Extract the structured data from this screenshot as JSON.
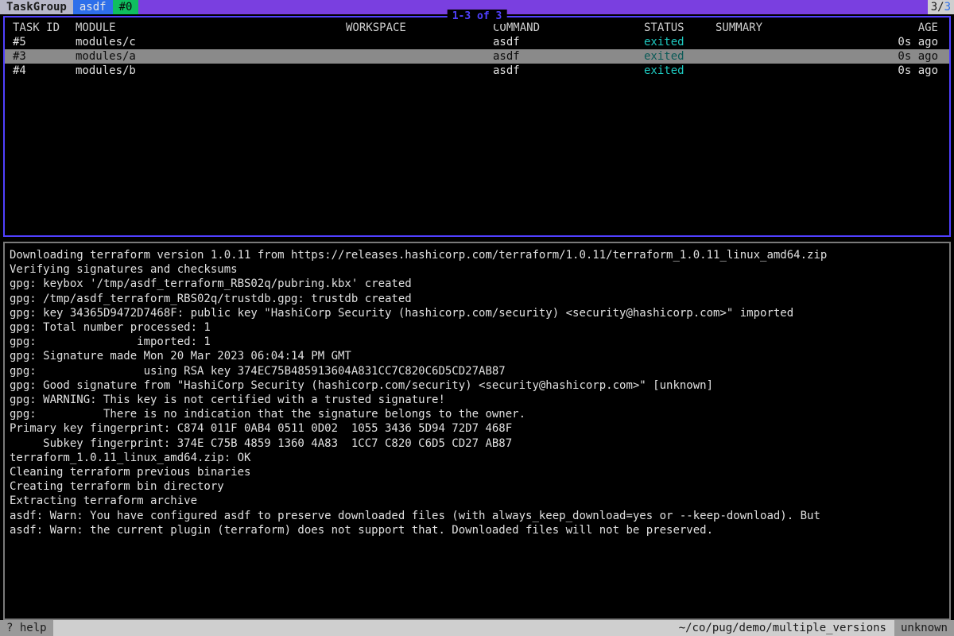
{
  "topbar": {
    "crumb_task": "TaskGroup",
    "crumb_cmd": "asdf",
    "crumb_id": "#0",
    "count_left": "3",
    "count_right": "3"
  },
  "task_panel": {
    "title": "1-3 of 3",
    "columns": {
      "task_id": "TASK ID",
      "module": "MODULE",
      "workspace": "WORKSPACE",
      "command": "COMMAND",
      "status": "STATUS",
      "summary": "SUMMARY",
      "age": "AGE"
    },
    "rows": [
      {
        "task_id": "#5",
        "module": "modules/c",
        "workspace": "",
        "command": "asdf",
        "status": "exited",
        "summary": "",
        "age": "0s ago",
        "selected": false
      },
      {
        "task_id": "#3",
        "module": "modules/a",
        "workspace": "",
        "command": "asdf",
        "status": "exited",
        "summary": "",
        "age": "0s ago",
        "selected": true
      },
      {
        "task_id": "#4",
        "module": "modules/b",
        "workspace": "",
        "command": "asdf",
        "status": "exited",
        "summary": "",
        "age": "0s ago",
        "selected": false
      }
    ]
  },
  "log_lines": [
    "Downloading terraform version 1.0.11 from https://releases.hashicorp.com/terraform/1.0.11/terraform_1.0.11_linux_amd64.zip",
    "Verifying signatures and checksums",
    "gpg: keybox '/tmp/asdf_terraform_RBS02q/pubring.kbx' created",
    "gpg: /tmp/asdf_terraform_RBS02q/trustdb.gpg: trustdb created",
    "gpg: key 34365D9472D7468F: public key \"HashiCorp Security (hashicorp.com/security) <security@hashicorp.com>\" imported",
    "gpg: Total number processed: 1",
    "gpg:               imported: 1",
    "gpg: Signature made Mon 20 Mar 2023 06:04:14 PM GMT",
    "gpg:                using RSA key 374EC75B485913604A831CC7C820C6D5CD27AB87",
    "gpg: Good signature from \"HashiCorp Security (hashicorp.com/security) <security@hashicorp.com>\" [unknown]",
    "gpg: WARNING: This key is not certified with a trusted signature!",
    "gpg:          There is no indication that the signature belongs to the owner.",
    "Primary key fingerprint: C874 011F 0AB4 0511 0D02  1055 3436 5D94 72D7 468F",
    "     Subkey fingerprint: 374E C75B 4859 1360 4A83  1CC7 C820 C6D5 CD27 AB87",
    "terraform_1.0.11_linux_amd64.zip: OK",
    "Cleaning terraform previous binaries",
    "Creating terraform bin directory",
    "Extracting terraform archive",
    "asdf: Warn: You have configured asdf to preserve downloaded files (with always_keep_download=yes or --keep-download). But",
    "asdf: Warn: the current plugin (terraform) does not support that. Downloaded files will not be preserved."
  ],
  "statusbar": {
    "help": "? help",
    "path": "~/co/pug/demo/multiple_versions",
    "workspace": "unknown"
  }
}
